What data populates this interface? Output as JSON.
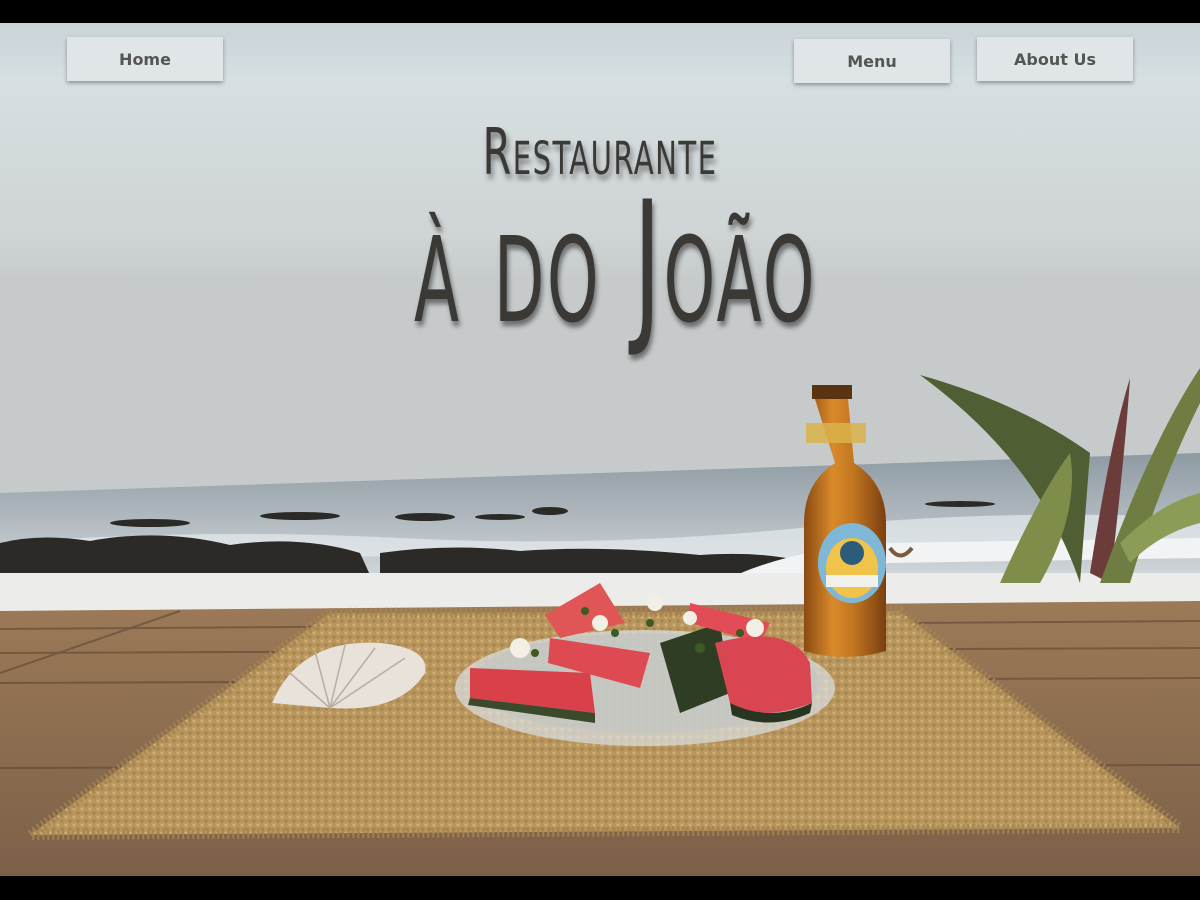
{
  "nav": {
    "home_label": "Home",
    "menu_label": "Menu",
    "about_label": "About Us"
  },
  "hero": {
    "title_line1": "Restaurante",
    "title_line2": "à do João"
  },
  "colors": {
    "title": "#3a3935",
    "button_bg": "#e1e6e8",
    "button_text": "#555555"
  }
}
